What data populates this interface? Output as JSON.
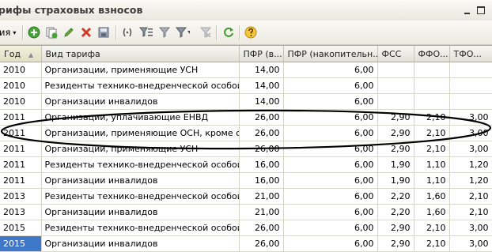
{
  "window": {
    "title": "рифы страховых взносов"
  },
  "toolbar": {
    "actions_label": "ия",
    "caret": "▾"
  },
  "grid": {
    "columns": [
      "Год",
      "Вид тарифа",
      "ПФР (в...",
      "ПФР (накопительн...",
      "ФСС",
      "ФФО...",
      "ТФО..."
    ],
    "rows": [
      [
        "2010",
        "Организации, применяющие УСН",
        "14,00",
        "6,00",
        "",
        "",
        ""
      ],
      [
        "2010",
        "Резиденты технико-внедренческой особой эк...",
        "14,00",
        "6,00",
        "",
        "",
        ""
      ],
      [
        "2010",
        "Организации инвалидов",
        "14,00",
        "6,00",
        "",
        "",
        ""
      ],
      [
        "2011",
        "Организации, уплачивающие ЕНВД",
        "26,00",
        "6,00",
        "2,90",
        "2,10",
        "3,00"
      ],
      [
        "2011",
        "Организации, применяющие ОСН, кроме с/х ...",
        "26,00",
        "6,00",
        "2,90",
        "2,10",
        "3,00"
      ],
      [
        "2011",
        "Организации, применяющие УСН",
        "26,00",
        "6,00",
        "2,90",
        "2,10",
        "3,00"
      ],
      [
        "2011",
        "Резиденты технико-внедренческой особой эк...",
        "16,00",
        "6,00",
        "1,90",
        "1,10",
        "1,20"
      ],
      [
        "2011",
        "Организации инвалидов",
        "16,00",
        "6,00",
        "1,90",
        "1,10",
        "1,20"
      ],
      [
        "2013",
        "Резиденты технико-внедренческой особой эк...",
        "21,00",
        "6,00",
        "2,20",
        "1,60",
        "2,10"
      ],
      [
        "2013",
        "Организации инвалидов",
        "21,00",
        "6,00",
        "2,20",
        "1,60",
        "2,10"
      ],
      [
        "2015",
        "Резиденты технико-внедренческой особой эк...",
        "26,00",
        "6,00",
        "2,90",
        "2,10",
        "3,00"
      ],
      [
        "2015",
        "Организации инвалидов",
        "26,00",
        "6,00",
        "2,90",
        "2,10",
        "3,00"
      ]
    ]
  },
  "colors": {
    "selection": "#3f78c9",
    "annotation": "#000000"
  }
}
